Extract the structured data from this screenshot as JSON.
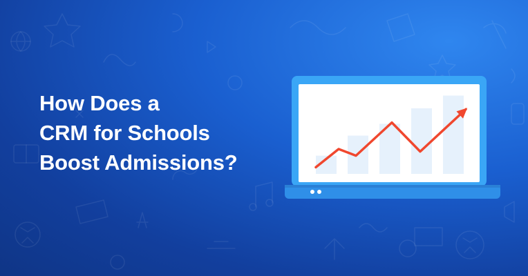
{
  "headline": {
    "lines": [
      "How Does a",
      "CRM for Schools",
      "Boost Admissions?"
    ]
  },
  "illustration": {
    "device": "laptop-icon",
    "chart_kind": "bar chart with rising trend arrow",
    "trend": [
      0.92,
      0.7,
      0.78,
      0.38,
      0.73,
      0.22
    ],
    "bar_levels": [
      0.2,
      0.42,
      0.55,
      0.72,
      0.86
    ],
    "colors": {
      "frame": "#3aa6f6",
      "screen": "#ffffff",
      "bars": "#e6f1fc",
      "trend_line": "#f0472e",
      "base": "#2f8fe8"
    }
  },
  "theme": {
    "background_gradient": [
      "#2f86ef",
      "#123f9e"
    ],
    "text": "#ffffff"
  },
  "decor": {
    "pattern": "education doodles (book, pencil, rocket, globe, soccer ball, music notes, stars)"
  }
}
